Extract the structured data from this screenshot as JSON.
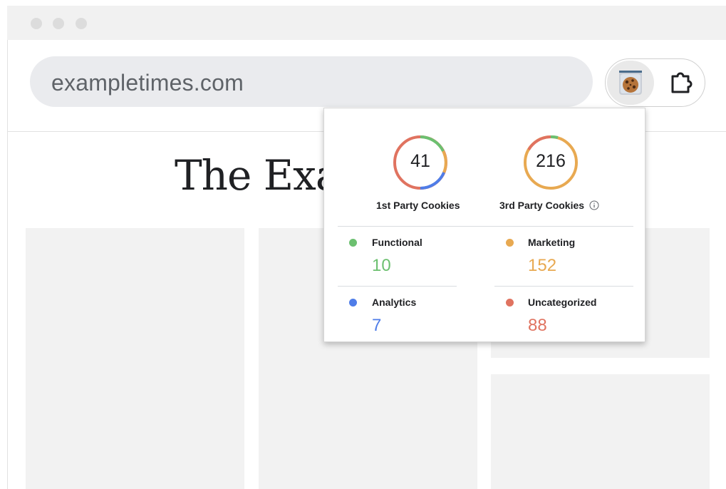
{
  "browser": {
    "url": "exampletimes.com",
    "extensions": [
      {
        "name": "cookie",
        "icon": "cookie-icon"
      },
      {
        "name": "extensions",
        "icon": "puzzle-icon"
      }
    ]
  },
  "page": {
    "headline": "The Exa"
  },
  "popup": {
    "first_party": {
      "count": "41",
      "label": "1st Party Cookies"
    },
    "third_party": {
      "count": "216",
      "label": "3rd Party Cookies",
      "info_icon": "info-icon"
    },
    "categories": [
      {
        "label": "Functional",
        "value": "10",
        "color": "#6cc070"
      },
      {
        "label": "Marketing",
        "value": "152",
        "color": "#e8a951"
      },
      {
        "label": "Analytics",
        "value": "7",
        "color": "#4f7de8"
      },
      {
        "label": "Uncategorized",
        "value": "88",
        "color": "#e07360"
      }
    ]
  }
}
